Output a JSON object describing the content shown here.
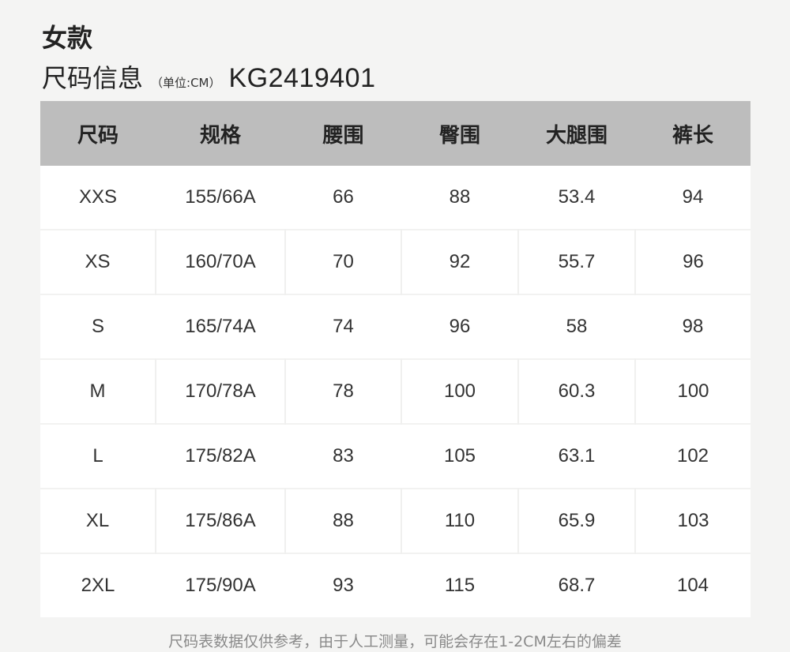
{
  "title": "女款",
  "subtitle": {
    "main": "尺码信息",
    "unit": "（单位:CM）",
    "code": "KG2419401"
  },
  "table": {
    "headers": [
      "尺码",
      "规格",
      "腰围",
      "臀围",
      "大腿围",
      "裤长"
    ],
    "rows": [
      [
        "XXS",
        "155/66A",
        "66",
        "88",
        "53.4",
        "94"
      ],
      [
        "XS",
        "160/70A",
        "70",
        "92",
        "55.7",
        "96"
      ],
      [
        "S",
        "165/74A",
        "74",
        "96",
        "58",
        "98"
      ],
      [
        "M",
        "170/78A",
        "78",
        "100",
        "60.3",
        "100"
      ],
      [
        "L",
        "175/82A",
        "83",
        "105",
        "63.1",
        "102"
      ],
      [
        "XL",
        "175/86A",
        "88",
        "110",
        "65.9",
        "103"
      ],
      [
        "2XL",
        "175/90A",
        "93",
        "115",
        "68.7",
        "104"
      ]
    ]
  },
  "footnote": "尺码表数据仅供参考，由于人工测量，可能会存在1-2CM左右的偏差"
}
